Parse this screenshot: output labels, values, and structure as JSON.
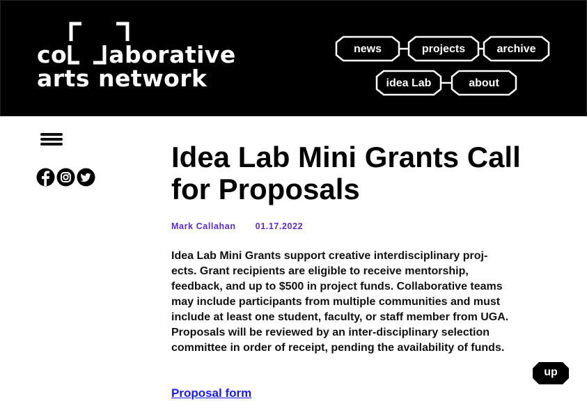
{
  "logo": {
    "line1_start": "co",
    "line1_end": "aborative",
    "line2": "arts network"
  },
  "nav": {
    "items": [
      {
        "label": "news"
      },
      {
        "label": "projects"
      },
      {
        "label": "archive"
      },
      {
        "label": "idea Lab"
      },
      {
        "label": "about"
      }
    ]
  },
  "sidebar": {
    "menu_icon": "hamburger-icon",
    "social": [
      "facebook-icon",
      "instagram-icon",
      "twitter-icon"
    ]
  },
  "article": {
    "title": "Idea Lab Mini Grants Call for Proposals",
    "author": "Mark Callahan",
    "date": "01.17.2022",
    "body": "Idea Lab Mini Grants support creative interdisciplinary proj-ects. Grant recipients are eligible to receive mentorship, feedback, and up to $500 in project funds. Collaborative teams may include participants from multiple communities and must include at least one student, faculty, or staff member from UGA. Proposals will be reviewed by an inter-disciplinary selection committee in order of receipt, pending the availability of funds.",
    "link_text": "Proposal form"
  },
  "up_button": {
    "label": "up"
  },
  "colors": {
    "header_bg": "#000000",
    "meta": "#5b2ad1",
    "link": "#1a1aff"
  }
}
